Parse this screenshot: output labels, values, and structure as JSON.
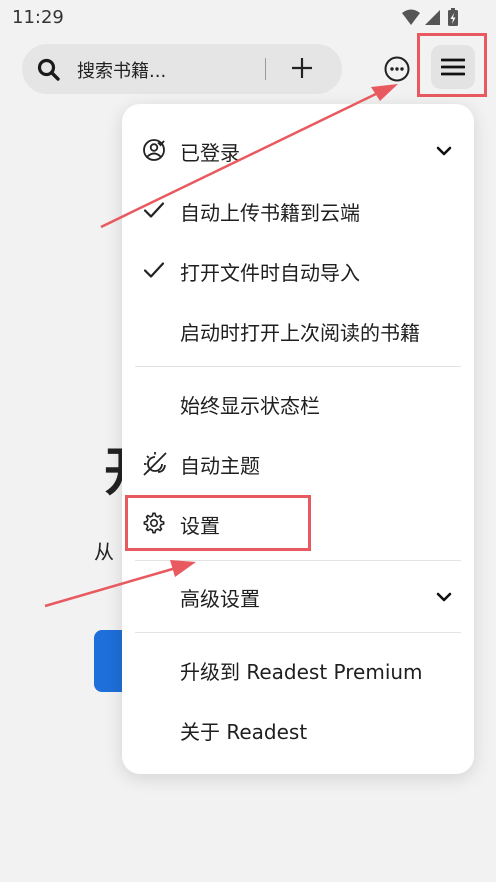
{
  "status_bar": {
    "time": "11:29"
  },
  "search": {
    "placeholder": "搜索书籍..."
  },
  "background": {
    "heading_partial": "开",
    "subtitle_partial": "从"
  },
  "menu": {
    "items": [
      {
        "label": "已登录",
        "icon": "account-icon",
        "trailing": "chevron-down-icon"
      },
      {
        "label": "自动上传书籍到云端",
        "icon": "check-icon"
      },
      {
        "label": "打开文件时自动导入",
        "icon": "check-icon"
      },
      {
        "label": "启动时打开上次阅读的书籍"
      },
      {
        "label": "始终显示状态栏"
      },
      {
        "label": "自动主题",
        "icon": "theme-auto-icon"
      },
      {
        "label": "设置",
        "icon": "gear-icon"
      },
      {
        "label": "高级设置",
        "trailing": "chevron-down-icon"
      },
      {
        "label": "升级到 Readest Premium"
      },
      {
        "label": "关于 Readest"
      }
    ]
  },
  "colors": {
    "annotation": "#e85a5f",
    "accent_blue": "#1e6fd9"
  }
}
